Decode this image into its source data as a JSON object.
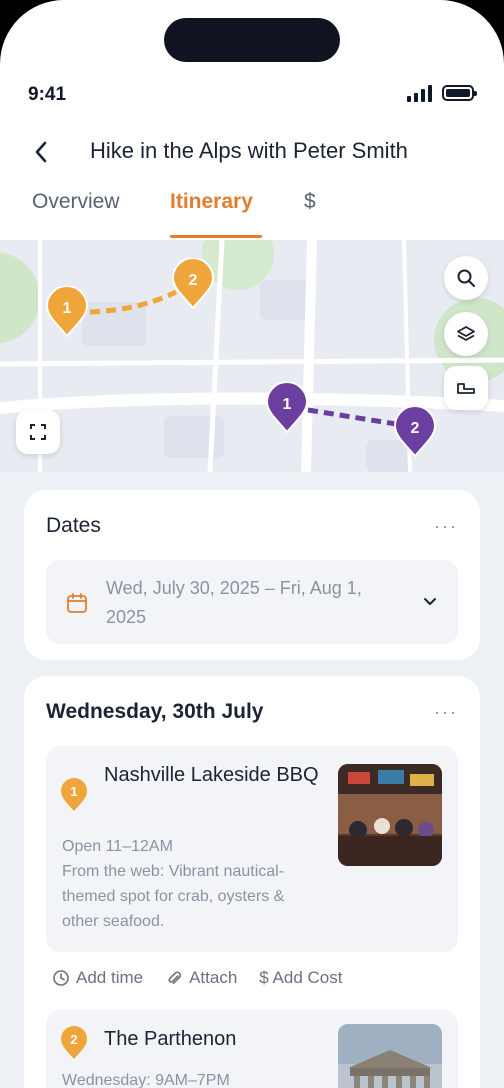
{
  "status": {
    "time": "9:41"
  },
  "header": {
    "title": "Hike in the Alps with Peter Smith"
  },
  "tabs": [
    {
      "label": "Overview"
    },
    {
      "label": "Itinerary"
    },
    {
      "label": "$"
    }
  ],
  "map": {
    "markers": [
      {
        "label": "1",
        "color": "#f0a53b"
      },
      {
        "label": "2",
        "color": "#f0a53b"
      },
      {
        "label": "1",
        "color": "#6b3fa0"
      },
      {
        "label": "2",
        "color": "#6b3fa0"
      }
    ],
    "controls": [
      "search-icon",
      "layers-icon",
      "ruler-icon",
      "fullscreen-icon"
    ]
  },
  "dates_card": {
    "title": "Dates",
    "more": "···",
    "range": "Wed, July 30, 2025 – Fri, Aug 1, 2025"
  },
  "day_card": {
    "title": "Wednesday, 30th July",
    "more": "···",
    "places": [
      {
        "number": "1",
        "name": "Nashville Lakeside BBQ",
        "hours": "Open 11–12AM",
        "description": "From the web: Vibrant nautical-themed spot for crab, oysters & other seafood."
      },
      {
        "number": "2",
        "name": "The Parthenon",
        "hours": "Wednesday: 9AM–7PM"
      }
    ],
    "actions": {
      "add_time": "Add time",
      "attach": "Attach",
      "add_cost": "$ Add Cost"
    }
  },
  "colors": {
    "accent": "#e07e2c",
    "text_dark": "#1b2434",
    "text_muted": "#8a93a3",
    "route_orange": "#f0a53b",
    "route_purple": "#6b3fa0"
  }
}
